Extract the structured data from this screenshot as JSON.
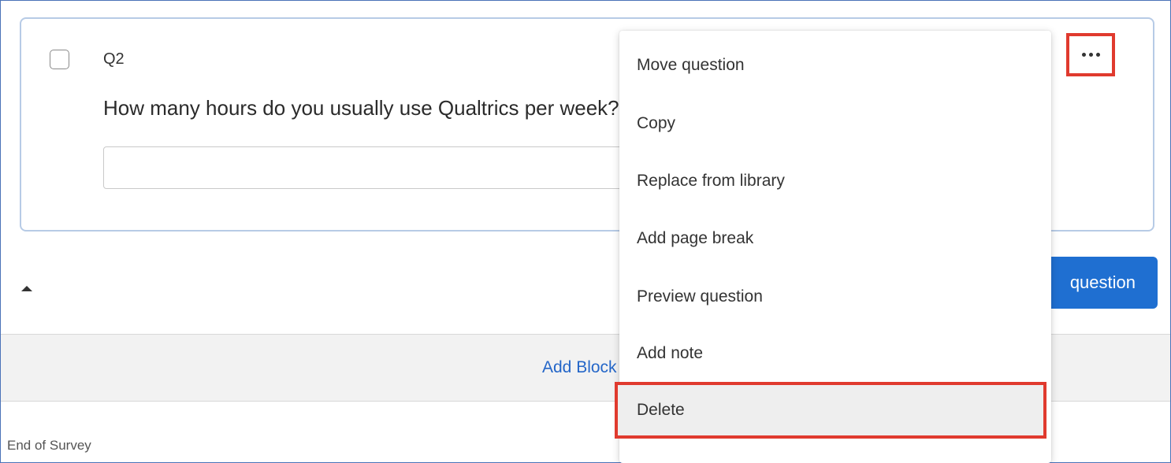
{
  "question": {
    "number": "Q2",
    "text": "How many hours do you usually use Qualtrics per week?",
    "answer_value": "",
    "checked": false
  },
  "toolbar": {
    "more_icon": "ellipsis-icon",
    "collapse_icon": "caret-up-icon",
    "add_question_label": "question"
  },
  "block": {
    "add_block_label": "Add Block"
  },
  "footer": {
    "end_of_survey": "End of Survey"
  },
  "context_menu": {
    "items": [
      {
        "label": "Move question"
      },
      {
        "label": "Copy"
      },
      {
        "label": "Replace from library"
      },
      {
        "label": "Add page break"
      },
      {
        "label": "Preview question"
      },
      {
        "label": "Add note"
      },
      {
        "label": "Delete"
      }
    ]
  },
  "colors": {
    "accent": "#1f6fd1",
    "highlight_border": "#e03a2e",
    "link": "#2466c8"
  }
}
